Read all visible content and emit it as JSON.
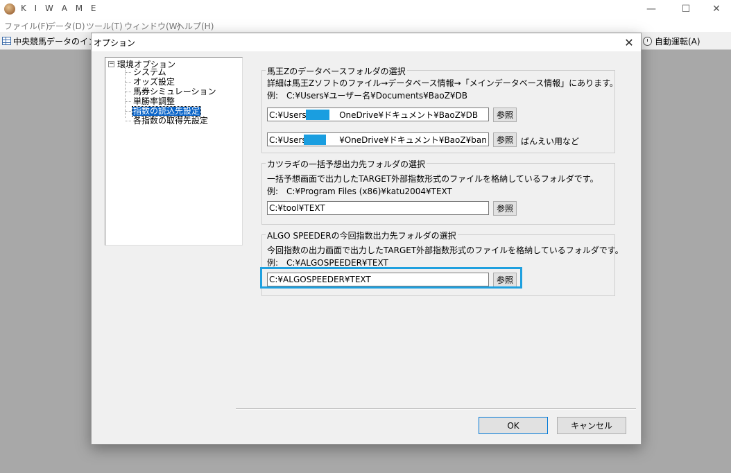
{
  "app": {
    "title": "K I W A M E",
    "menu": [
      "ファイル(F)",
      "データ(D)",
      "ツール(T)",
      "ウィンドウ(W)",
      "ヘルプ(H)"
    ],
    "window_controls": {
      "minimize": "—",
      "maximize": "☐",
      "close": "✕"
    }
  },
  "toolbar": {
    "tab_label": "中央競馬データのインポ",
    "autorun_label": "自動運転(A)"
  },
  "dialog": {
    "title": "オプション",
    "close": "✕",
    "tree": {
      "expander": "−",
      "root": "環境オプション",
      "items": [
        "システム",
        "オッズ設定",
        "馬券シミュレーション",
        "単勝率調整",
        "指数の読込先設定",
        "各指数の取得先設定"
      ],
      "selected_index": 4
    },
    "groups": [
      {
        "title": "馬王Zのデータベースフォルダの選択",
        "desc": "詳細は馬王Zソフトのファイル→データベース情報→「メインデータベース情報」にあります。",
        "example": "例:　C:¥Users¥ユーザー名¥Documents¥BaoZ¥DB",
        "input1": "C:¥Users¥　　　 OneDrive¥ドキュメント¥BaoZ¥DB",
        "input2": "C:¥Users¥　　　 ¥OneDrive¥ドキュメント¥BaoZ¥banei¥DB",
        "browse1": "参照",
        "browse2": "参照",
        "note": "ばんえい用など"
      },
      {
        "title": "カツラギの一括予想出力先フォルダの選択",
        "desc": "一括予想画面で出力したTARGET外部指数形式のファイルを格納しているフォルダです。",
        "example": "例:　C:¥Program Files (x86)¥katu2004¥TEXT",
        "input": "C:¥tool¥TEXT",
        "browse": "参照"
      },
      {
        "title": "ALGO SPEEDERの今回指数出力先フォルダの選択",
        "desc": "今回指数の出力画面で出力したTARGET外部指数形式のファイルを格納しているフォルダです。",
        "example": "例:　C:¥ALGOSPEEDER¥TEXT",
        "input": "C:¥ALGOSPEEDER¥TEXT",
        "browse": "参照"
      }
    ],
    "ok_label": "OK",
    "cancel_label": "キャンセル"
  }
}
